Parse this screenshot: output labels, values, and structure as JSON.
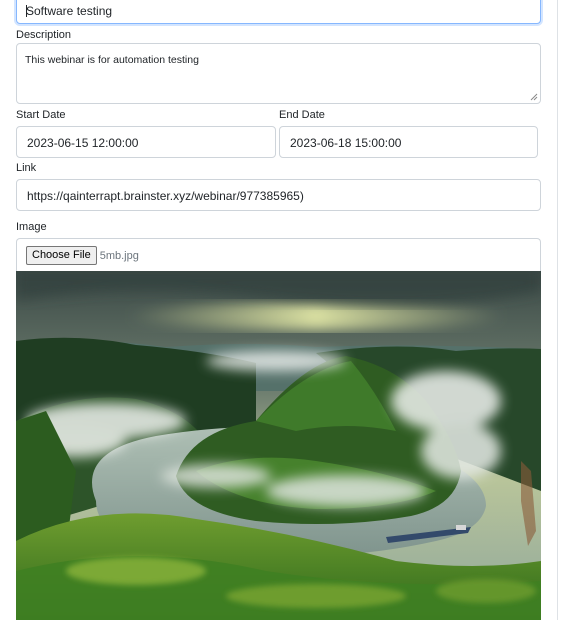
{
  "form": {
    "title_value": "Software testing",
    "description_label": "Description",
    "description_value": "This webinar is for automation testing",
    "start_date_label": "Start Date",
    "start_date_value": "2023-06-15 12:00:00",
    "end_date_label": "End Date",
    "end_date_value": "2023-06-18 15:00:00",
    "link_label": "Link",
    "link_value": "https://qainterrapt.brainster.xyz/webinar/977385965)",
    "image_label": "Image",
    "choose_file_label": "Choose File",
    "file_name": "5mb.jpg"
  },
  "colors": {
    "focus_border": "#86b7fe",
    "input_border": "#ced4da",
    "text": "#212529"
  },
  "preview": {
    "description": "landscape photo: river meander through green hills with low fog and a cargo barge"
  }
}
